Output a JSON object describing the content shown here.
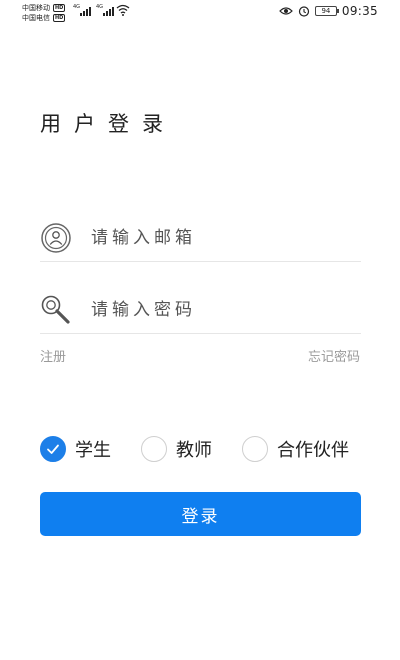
{
  "status_bar": {
    "carrier_1": "中国移动",
    "carrier_2": "中国电信",
    "hd_badge": "HD",
    "network_type": "4G",
    "battery": "94",
    "time": "09:35",
    "icons": [
      "signal-icon",
      "wifi-icon",
      "eye-icon",
      "alarm-icon",
      "battery-icon"
    ]
  },
  "login": {
    "title": "用户登录",
    "email_placeholder": "请输入邮箱",
    "password_placeholder": "请输入密码",
    "register_link": "注册",
    "forgot_link": "忘记密码",
    "roles": [
      {
        "label": "学生",
        "selected": true
      },
      {
        "label": "教师",
        "selected": false
      },
      {
        "label": "合作伙伴",
        "selected": false
      }
    ],
    "submit_label": "登录"
  },
  "colors": {
    "accent": "#0f7ff0",
    "radio_checked": "#1d7fe8",
    "link_gray": "#9a9a9a",
    "divider": "#e6e6e6"
  }
}
